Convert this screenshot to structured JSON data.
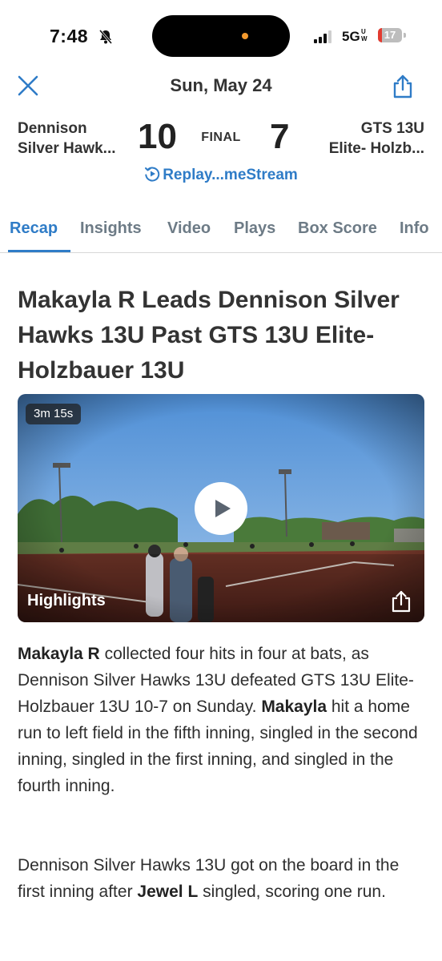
{
  "status_bar": {
    "time": "7:48",
    "network": "5G",
    "network_sub": "UW",
    "battery": "17",
    "accent_colors": {
      "battery_low": "#e23b30",
      "island_dot": "#f39a2e"
    }
  },
  "header": {
    "close_icon": "close-icon",
    "date": "Sun, May 24",
    "share_icon": "share-icon"
  },
  "scoreboard": {
    "home_team_line1": "Dennison",
    "home_team_line2": "Silver Hawk...",
    "home_score": "10",
    "status": "FINAL",
    "away_score": "7",
    "away_team_line1": "GTS 13U",
    "away_team_line2": "Elite- Holzb...",
    "replay_label": "Replay...meStream",
    "replay_icon": "replay-play-icon"
  },
  "tabs": [
    {
      "label": "Recap",
      "active": true
    },
    {
      "label": "Insights",
      "active": false
    },
    {
      "label": "Video",
      "active": false
    },
    {
      "label": "Plays",
      "active": false
    },
    {
      "label": "Box Score",
      "active": false
    },
    {
      "label": "Info",
      "active": false
    }
  ],
  "article": {
    "headline": "Makayla R Leads Dennison Silver Hawks 13U Past GTS 13U Elite- Holzbauer 13U",
    "video": {
      "duration": "3m 15s",
      "label": "Highlights",
      "play_icon": "play-icon",
      "share_icon": "share-icon"
    },
    "paragraph1": {
      "bold1": "Makayla R",
      "text1": " collected four hits in four at bats, as Dennison Silver Hawks 13U defeated GTS 13U Elite- Holzbauer 13U 10-7 on Sunday. ",
      "bold2": "Makayla",
      "text2": " hit a home run to left field in the fifth inning, singled in the second inning, singled in the first inning, and singled in the fourth inning."
    },
    "paragraph2": {
      "text1": "Dennison Silver Hawks 13U got on the board in the first inning after ",
      "bold1": "Jewel L",
      "text2": " singled, scoring one run."
    }
  },
  "theme": {
    "accent": "#2f7cc7",
    "tab_inactive": "#6d7b86"
  }
}
